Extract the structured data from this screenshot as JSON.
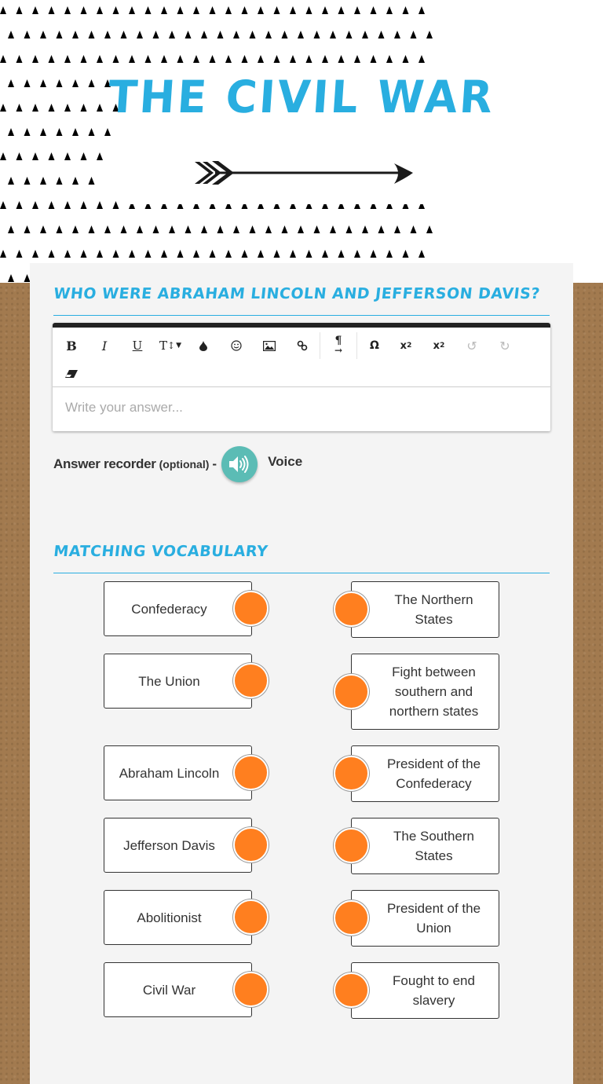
{
  "header": {
    "title": "The Civil War",
    "pattern_color": "#000000",
    "title_color": "#29aee0"
  },
  "question": {
    "heading": "Who were Abraham Lincoln and Jefferson Davis?",
    "toolbar": {
      "buttons": [
        {
          "icon": "bold-icon",
          "glyph": "B"
        },
        {
          "icon": "italic-icon",
          "glyph": "I"
        },
        {
          "icon": "underline-icon",
          "glyph": "U"
        },
        {
          "icon": "font-size-icon",
          "glyph": "T↕▾"
        },
        {
          "icon": "color-drop-icon",
          "glyph": "💧"
        },
        {
          "icon": "emoji-icon",
          "glyph": "☺"
        },
        {
          "icon": "image-icon",
          "glyph": "🖼"
        },
        {
          "icon": "link-icon",
          "glyph": "⚭"
        },
        {
          "icon": "paragraph-direction-icon",
          "glyph": "¶"
        },
        {
          "icon": "special-char-icon",
          "glyph": "Ω"
        },
        {
          "icon": "subscript-icon",
          "glyph": "x₂"
        },
        {
          "icon": "superscript-icon",
          "glyph": "x²"
        },
        {
          "icon": "undo-icon",
          "glyph": "↺"
        },
        {
          "icon": "redo-icon",
          "glyph": "↻"
        },
        {
          "icon": "clear-format-icon",
          "glyph": "⌫"
        }
      ]
    },
    "answer_placeholder": "Write your answer...",
    "recorder": {
      "label": "Answer recorder",
      "optional": "(optional)",
      "dash": "-",
      "voice_label": "Voice"
    }
  },
  "matching": {
    "heading": "Matching Vocabulary",
    "dot_color": "#ff7f1f",
    "left": [
      "Confederacy",
      "The Union",
      "Abraham Lincoln",
      "Jefferson Davis",
      "Abolitionist",
      "Civil War"
    ],
    "right": [
      "The Northern States",
      "Fight between southern and northern states",
      "President of the Confederacy",
      "The Southern States",
      "President of the Union",
      "Fought to end slavery"
    ]
  }
}
